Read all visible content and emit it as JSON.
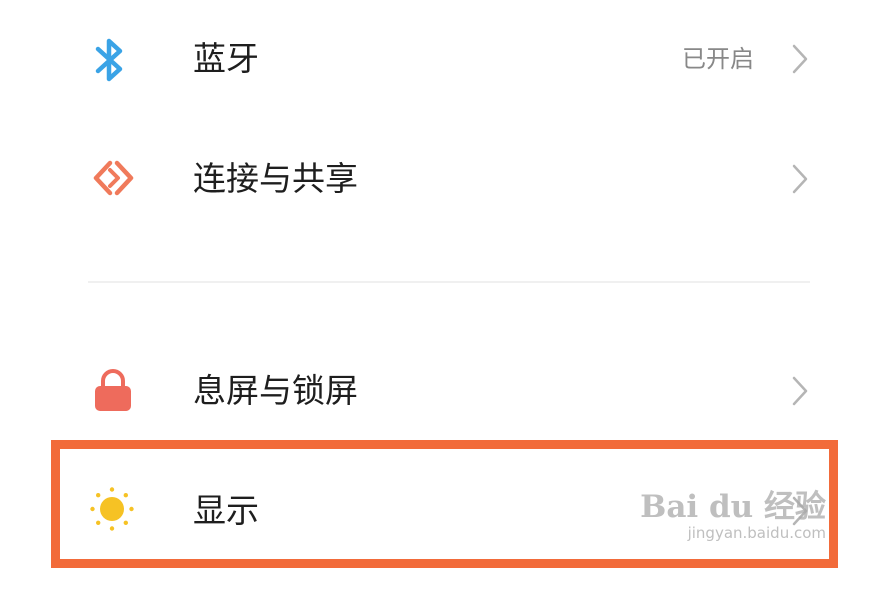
{
  "settings": {
    "items": [
      {
        "label": "蓝牙",
        "value": "已开启",
        "icon": "bluetooth-icon",
        "icon_color": "#3aa3e6"
      },
      {
        "label": "连接与共享",
        "value": "",
        "icon": "connection-sharing-icon",
        "icon_color": "#f07a5b"
      },
      {
        "label": "息屏与锁屏",
        "value": "",
        "icon": "lock-icon",
        "icon_color": "#ee6b5c"
      },
      {
        "label": "显示",
        "value": "",
        "icon": "sun-icon",
        "icon_color": "#f6c224"
      }
    ]
  },
  "highlight": {
    "target": "显示",
    "color": "#f26b3a"
  },
  "watermark": {
    "brand": "Bai du 经验",
    "url": "jingyan.baidu.com"
  }
}
